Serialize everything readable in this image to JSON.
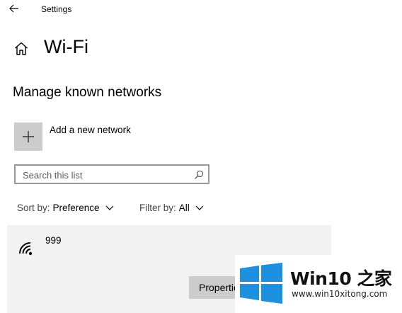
{
  "window": {
    "title": "Settings"
  },
  "header": {
    "title": "Wi-Fi"
  },
  "section": {
    "title": "Manage known networks"
  },
  "add_network": {
    "label": "Add a new network"
  },
  "search": {
    "placeholder": "Search this list",
    "value": ""
  },
  "sort": {
    "label": "Sort by:",
    "value": "Preference"
  },
  "filter": {
    "label": "Filter by:",
    "value": "All"
  },
  "networks": [
    {
      "name": "999",
      "properties_label": "Properties"
    }
  ],
  "watermark": {
    "brand": "Win10 之家",
    "url": "www.win10xitong.com"
  },
  "colors": {
    "tile_gray": "#cccccc",
    "item_bg": "#f2f2f2",
    "logo_blue": "#1e90e0"
  },
  "icons": [
    "back-arrow-icon",
    "home-icon",
    "plus-icon",
    "search-icon",
    "chevron-down-icon",
    "wifi-icon",
    "windows-logo-icon"
  ]
}
